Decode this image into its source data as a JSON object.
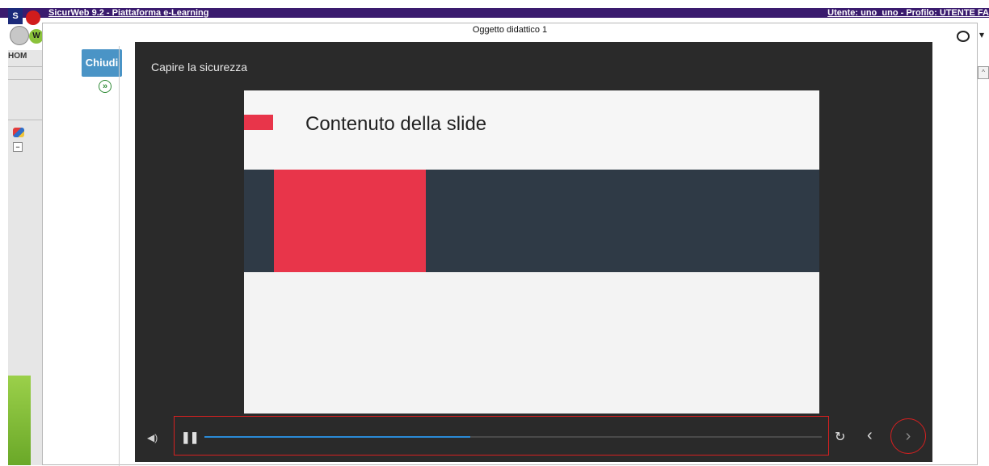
{
  "app": {
    "title": "SicurWeb 9.2 - Piattaforma e-Learning",
    "user_info": "Utente: uno_uno - Profilo: UTENTE FA",
    "logo_letters": {
      "s": "S",
      "w": "W"
    },
    "home_tab": "HOM"
  },
  "modal": {
    "title": "Oggetto didattico 1",
    "close_label": "Chiudi",
    "expand_icon": "double-chevron-right-icon"
  },
  "player": {
    "course_title": "Capire la sicurezza",
    "slide_title": "Contenuto della slide",
    "progress": 0.43,
    "icons": {
      "volume": "volume-icon",
      "pause": "pause-icon",
      "replay": "replay-icon",
      "prev": "chevron-left-icon",
      "next": "chevron-right-icon"
    }
  },
  "colors": {
    "topbar": "#3a1b6e",
    "accent_blue": "#4a94c6",
    "slide_red": "#e8354a",
    "slide_band": "#2f3a46",
    "progress": "#2a8ad6",
    "highlight": "#d62020"
  }
}
